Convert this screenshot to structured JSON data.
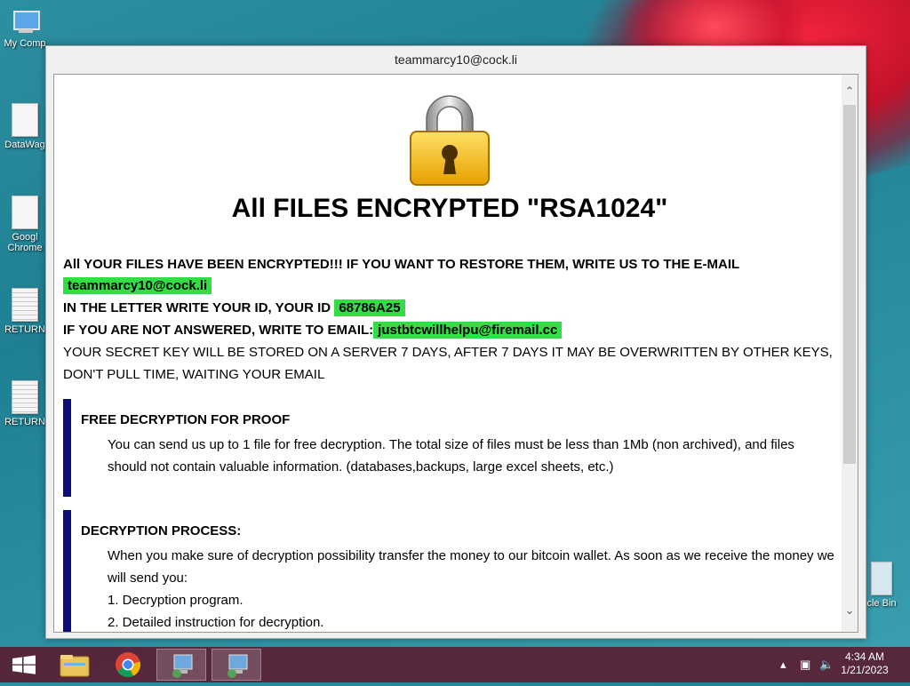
{
  "desktop": {
    "icons": [
      {
        "label": "My Comp"
      },
      {
        "label": "DataWag"
      },
      {
        "label": "Googl Chrome"
      },
      {
        "label": "RETURN"
      },
      {
        "label": "RETURN"
      },
      {
        "label": "cle Bin"
      }
    ]
  },
  "window": {
    "title": "teammarcy10@cock.li",
    "headline": "All FILES ENCRYPTED \"RSA1024\"",
    "line1": "All YOUR FILES HAVE BEEN ENCRYPTED!!! IF YOU WANT TO RESTORE THEM, WRITE US TO THE E-MAIL",
    "email1": "teammarcy10@cock.li",
    "id_label": "IN THE LETTER WRITE YOUR ID, YOUR ID",
    "id_value": "68786A25",
    "alt_label": "IF YOU ARE NOT ANSWERED, WRITE TO EMAIL:",
    "email2": "justbtcwillhelpu@firemail.cc",
    "secret_line1": "YOUR SECRET KEY WILL BE STORED ON A SERVER 7 DAYS, AFTER 7 DAYS IT MAY BE OVERWRITTEN BY OTHER KEYS,",
    "secret_line2": "DON'T PULL TIME, WAITING YOUR EMAIL",
    "sections": [
      {
        "title": "FREE DECRYPTION FOR PROOF",
        "lines": [
          "You can send us up to 1 file for free decryption. The total size of files must be less than 1Mb (non archived), and files",
          "should not contain valuable information. (databases,backups, large excel sheets, etc.)"
        ]
      },
      {
        "title": "DECRYPTION PROCESS:",
        "lines": [
          "When you make sure of decryption possibility transfer the money to our bitcoin wallet. As soon as we receive the money we",
          "will send you:",
          "1. Decryption program.",
          "2. Detailed instruction for decryption."
        ]
      }
    ],
    "lock_icon": "padlock-icon"
  },
  "taskbar": {
    "items": [
      "start-icon",
      "file-explorer-icon",
      "chrome-icon",
      "program-icon",
      "program-icon"
    ],
    "time": "4:34 AM",
    "date": "1/21/2023"
  },
  "colors": {
    "highlight": "#33dd44",
    "section_bar": "#0e0e7a"
  }
}
